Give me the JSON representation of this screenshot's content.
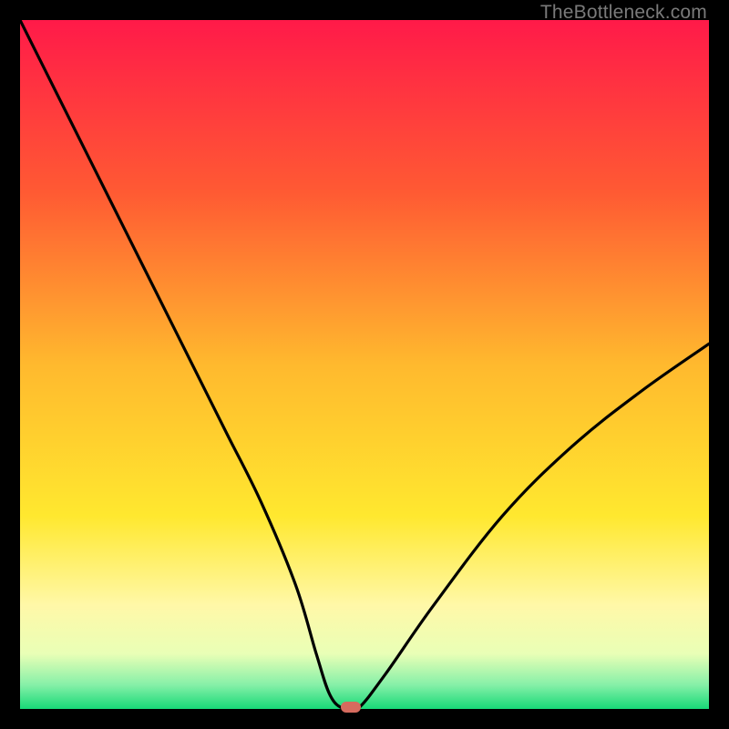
{
  "watermark": "TheBottleneck.com",
  "marker_color": "#d66b5e",
  "chart_data": {
    "type": "line",
    "title": "",
    "xlabel": "",
    "ylabel": "",
    "x": [
      0,
      5,
      10,
      15,
      20,
      25,
      30,
      35,
      40,
      43,
      45,
      47,
      49,
      53,
      60,
      70,
      80,
      90,
      100
    ],
    "values": [
      100,
      90,
      80,
      70,
      60,
      50,
      40,
      30,
      18,
      8,
      2,
      0,
      0,
      5,
      15,
      28,
      38,
      46,
      53
    ],
    "xlim": [
      0,
      100
    ],
    "ylim": [
      0,
      100
    ],
    "marker_point": {
      "x": 48,
      "y": 0
    },
    "gradient_stops": [
      {
        "pos": 0.0,
        "color": "#ff1a49"
      },
      {
        "pos": 0.25,
        "color": "#ff5a33"
      },
      {
        "pos": 0.5,
        "color": "#ffb92e"
      },
      {
        "pos": 0.72,
        "color": "#ffe82f"
      },
      {
        "pos": 0.85,
        "color": "#fff8a8"
      },
      {
        "pos": 0.92,
        "color": "#e9ffb6"
      },
      {
        "pos": 0.965,
        "color": "#86f0a8"
      },
      {
        "pos": 1.0,
        "color": "#17d977"
      }
    ]
  }
}
